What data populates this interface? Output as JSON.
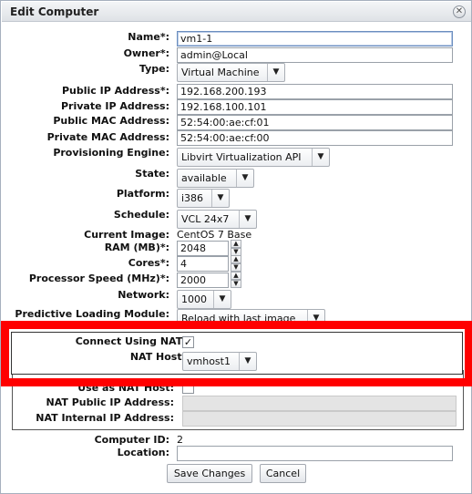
{
  "dialog": {
    "title": "Edit Computer"
  },
  "fields": {
    "name": {
      "label": "Name*:",
      "value": "vm1-1"
    },
    "owner": {
      "label": "Owner*:",
      "value": "admin@Local"
    },
    "type": {
      "label": "Type:",
      "value": "Virtual Machine"
    },
    "public_ip": {
      "label": "Public IP Address*:",
      "value": "192.168.200.193"
    },
    "private_ip": {
      "label": "Private IP Address:",
      "value": "192.168.100.101"
    },
    "public_mac": {
      "label": "Public MAC Address:",
      "value": "52:54:00:ae:cf:01"
    },
    "private_mac": {
      "label": "Private MAC Address:",
      "value": "52:54:00:ae:cf:00"
    },
    "provisioning": {
      "label": "Provisioning Engine:",
      "value": "Libvirt Virtualization API"
    },
    "state": {
      "label": "State:",
      "value": "available"
    },
    "platform": {
      "label": "Platform:",
      "value": "i386"
    },
    "schedule": {
      "label": "Schedule:",
      "value": "VCL 24x7"
    },
    "current_image": {
      "label": "Current Image:",
      "value": "CentOS 7 Base"
    },
    "ram": {
      "label": "RAM (MB)*:",
      "value": "2048"
    },
    "cores": {
      "label": "Cores*:",
      "value": "4"
    },
    "proc_speed": {
      "label": "Processor Speed (MHz)*:",
      "value": "2000"
    },
    "network": {
      "label": "Network:",
      "value": "1000"
    },
    "predictive": {
      "label": "Predictive Loading Module:",
      "value": "Reload with last image"
    },
    "connect_nat": {
      "label": "Connect Using NAT:",
      "checked": true
    },
    "nat_host": {
      "label": "NAT Host:",
      "value": "vmhost1"
    },
    "use_as_nat": {
      "label": "Use as NAT Host:",
      "checked": false
    },
    "nat_public_ip": {
      "label": "NAT Public IP Address:",
      "value": ""
    },
    "nat_internal_ip": {
      "label": "NAT Internal IP Address:",
      "value": ""
    },
    "computer_id": {
      "label": "Computer ID:",
      "value": "2"
    },
    "location": {
      "label": "Location:",
      "value": ""
    }
  },
  "buttons": {
    "save": "Save Changes",
    "cancel": "Cancel"
  },
  "icons": {
    "close": "close-icon",
    "dropdown": "chevron-down-icon",
    "check": "checkmark-icon"
  },
  "colors": {
    "highlight": "#ff0000"
  }
}
